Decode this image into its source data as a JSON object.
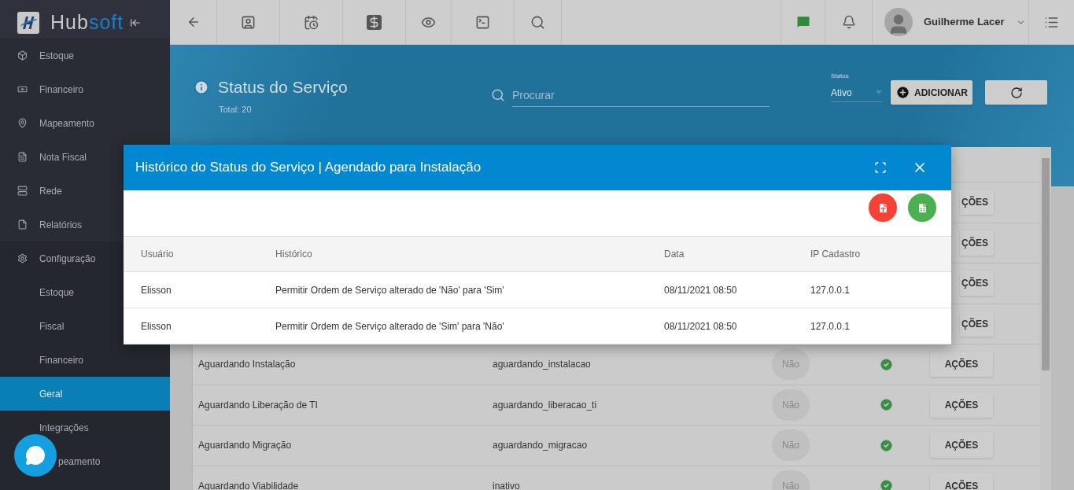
{
  "app": {
    "logo": "Hub",
    "logo_accent": "soft"
  },
  "sidebar": {
    "items": [
      {
        "label": "Estoque",
        "selected": false
      },
      {
        "label": "Financeiro",
        "selected": false
      },
      {
        "label": "Mapeamento",
        "selected": false
      },
      {
        "label": "Nota Fiscal",
        "selected": false
      },
      {
        "label": "Rede",
        "selected": false
      },
      {
        "label": "Relatórios",
        "selected": false
      },
      {
        "label": "Configuração",
        "selected": false,
        "expanded": true,
        "children": [
          {
            "label": "Estoque",
            "selected": false
          },
          {
            "label": "Fiscal",
            "selected": false
          },
          {
            "label": "Financeiro",
            "selected": false
          },
          {
            "label": "Geral",
            "selected": true
          },
          {
            "label": "Integrações",
            "selected": false
          },
          {
            "label": "peamento",
            "selected": false,
            "covered": true
          }
        ]
      }
    ]
  },
  "topbar": {
    "user": "Guilherme Lacer"
  },
  "page": {
    "title": "Status do Serviço",
    "total": "Total: 20",
    "search": {
      "placeholder": "Procurar"
    },
    "status": {
      "label": "Status",
      "value": "Ativo"
    },
    "add_button": "ADICIONAR"
  },
  "table": {
    "rows": [
      {
        "action": "ÇÕES",
        "covered": true
      },
      {
        "action": "ÇÕES",
        "covered": true
      },
      {
        "action": "ÇÕES",
        "covered": true
      },
      {
        "action": "ÇÕES",
        "covered": true
      },
      {
        "name": "Aguardando Instalação",
        "code": "aguardando_instalacao",
        "flag": "Não",
        "active": true,
        "action": "AÇÕES"
      },
      {
        "name": "Aguardando Liberação de TI",
        "code": "aguardando_liberacao_ti",
        "flag": "Não",
        "active": true,
        "action": "AÇÕES"
      },
      {
        "name": "Aguardando Migração",
        "code": "aguardando_migracao",
        "flag": "Não",
        "active": true,
        "action": "AÇÕES"
      },
      {
        "name": "Aguardando Viabilidade",
        "code": "inativo",
        "flag": "Não",
        "active": true,
        "action": "AÇÕES"
      }
    ]
  },
  "modal": {
    "title": "Histórico do Status do Serviço | Agendado para Instalação",
    "columns": [
      "Usuário",
      "Histórico",
      "Data",
      "IP Cadastro"
    ],
    "rows": [
      [
        "Elisson",
        "Permitir Ordem de Serviço alterado de 'Não' para 'Sim'",
        "08/11/2021 08:50",
        "127.0.0.1"
      ],
      [
        "Elisson",
        "Permitir Ordem de Serviço alterado de 'Sim' para 'Não'",
        "08/11/2021 08:50",
        "127.0.0.1"
      ]
    ]
  }
}
